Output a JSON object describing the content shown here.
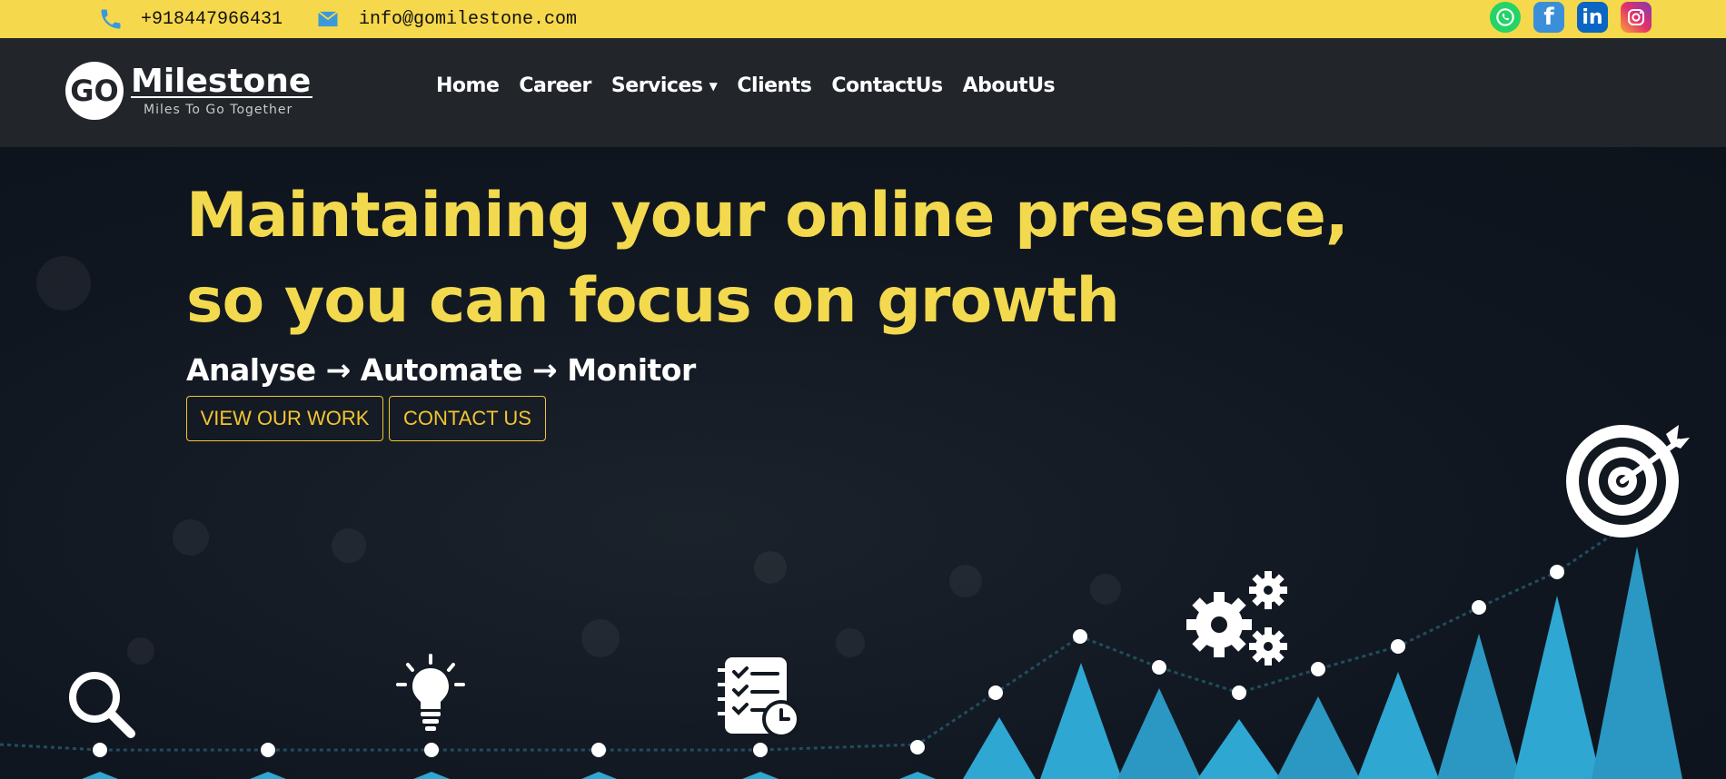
{
  "topbar": {
    "phone": "+918447966431",
    "email": "info@gomilestone.com",
    "social": [
      "whatsapp-icon",
      "facebook-icon",
      "linkedin-icon",
      "instagram-icon"
    ]
  },
  "logo": {
    "mark": "GO",
    "name": "Milestone",
    "tagline": "Miles To Go Together"
  },
  "nav": {
    "home": "Home",
    "career": "Career",
    "services": "Services",
    "clients": "Clients",
    "contact": "ContactUs",
    "about": "AboutUs"
  },
  "hero": {
    "headline_line1": "Maintaining your online presence,",
    "headline_line2": "so you can focus on growth",
    "subtitle": "Analyse → Automate → Monitor",
    "btn_work": "VIEW OUR WORK",
    "btn_contact": "CONTACT US",
    "icons": [
      "search-icon",
      "lightbulb-icon",
      "checklist-icon",
      "gears-icon",
      "target-icon"
    ]
  },
  "colors": {
    "accent": "#f6d84c",
    "navbar": "#22262b",
    "background": "#121820",
    "chart_blue": "#2ea7d3"
  }
}
